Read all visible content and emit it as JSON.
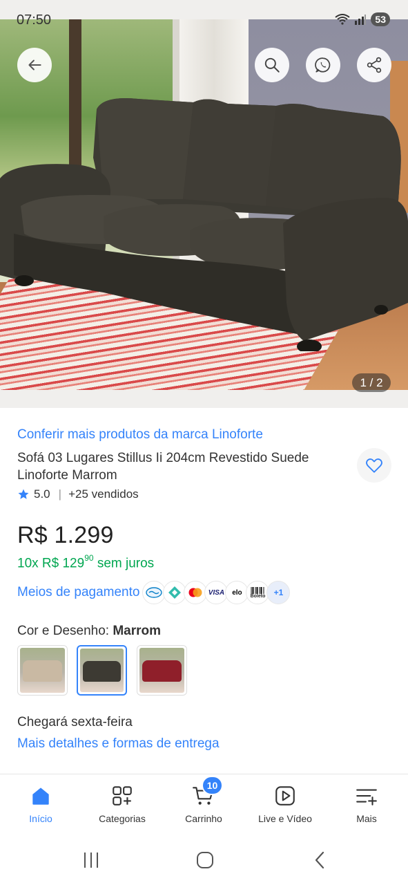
{
  "status_bar": {
    "time": "07:50",
    "battery": "53"
  },
  "hero": {
    "pager": "1 / 2",
    "buttons": [
      "back-icon",
      "search-icon",
      "whatsapp-icon",
      "share-icon"
    ]
  },
  "product": {
    "brand_link": "Conferir mais produtos da marca Linoforte",
    "title": "Sofá 03 Lugares Stillus Ii 204cm Revestido Suede Linoforte Marrom",
    "rating": "5.0",
    "sold": "+25 vendidos",
    "price": "R$ 1.299",
    "installments_prefix": "10x R$ 129",
    "installments_cents": "90",
    "installments_suffix": "sem juros",
    "payment_label": "Meios de pagamento",
    "payment_icons": {
      "visa": "VISA",
      "elo": "elo",
      "boleto": "Boleto",
      "more": "+1"
    },
    "variant_label": "Cor e Desenho:",
    "variant_value": "Marrom",
    "variants": [
      {
        "color": "#c9b9a3",
        "selected": false
      },
      {
        "color": "#3d3a33",
        "selected": true
      },
      {
        "color": "#8f1f2a",
        "selected": false
      }
    ],
    "delivery": "Chegará sexta-feira",
    "delivery_link": "Mais detalhes e formas de entrega"
  },
  "bottom_nav": {
    "items": [
      {
        "label": "Início",
        "icon": "home-icon",
        "active": true
      },
      {
        "label": "Categorias",
        "icon": "categories-icon",
        "active": false
      },
      {
        "label": "Carrinho",
        "icon": "cart-icon",
        "active": false
      },
      {
        "label": "Live e Vídeo",
        "icon": "play-icon",
        "active": false
      },
      {
        "label": "Mais",
        "icon": "menu-plus-icon",
        "active": false
      }
    ],
    "cart_count": "10"
  },
  "colors": {
    "accent": "#3483fa",
    "green": "#00a650",
    "text": "#333333"
  }
}
